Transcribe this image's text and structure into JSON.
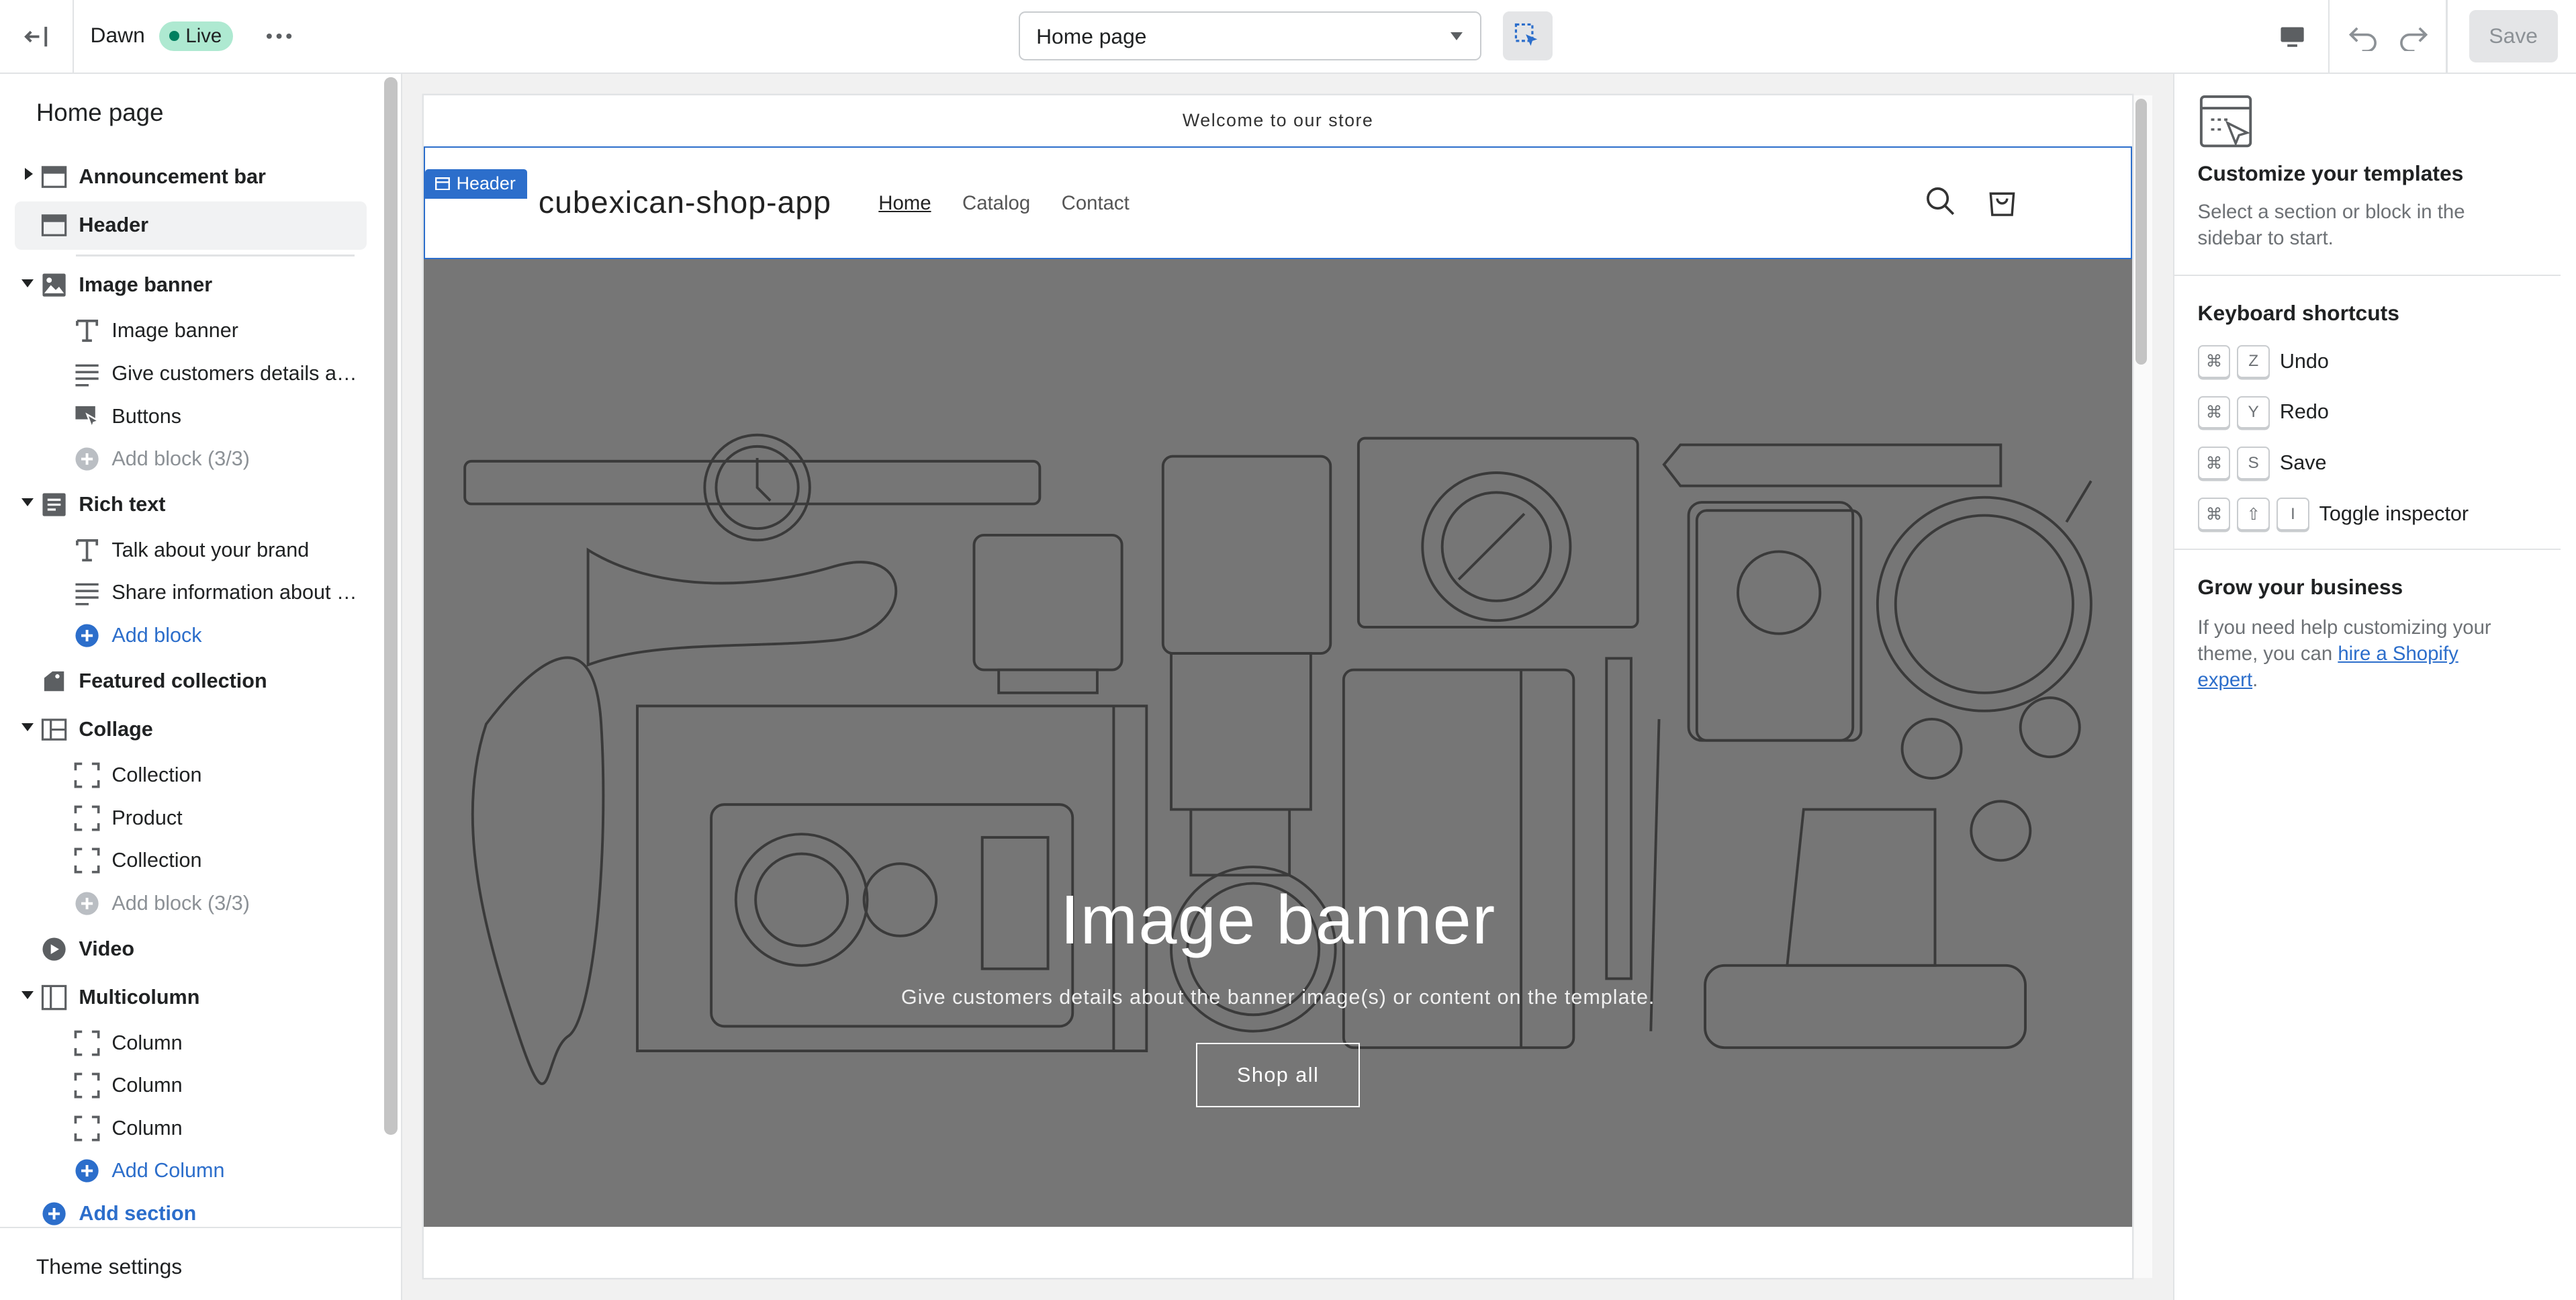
{
  "topbar": {
    "theme_name": "Dawn",
    "live_label": "Live",
    "template_select": "Home page",
    "save_label": "Save"
  },
  "sidebar": {
    "title": "Home page",
    "rows": [
      {
        "kind": "sec",
        "arrow": "right",
        "icon": "announcement-bar-icon",
        "label": "Announcement bar"
      },
      {
        "kind": "sec",
        "sel": true,
        "icon": "header-icon",
        "label": "Header"
      },
      {
        "kind": "sep"
      },
      {
        "kind": "sec",
        "arrow": "down",
        "icon": "image-icon",
        "label": "Image banner"
      },
      {
        "kind": "blk",
        "icon": "text-icon",
        "label": "Image banner"
      },
      {
        "kind": "blk",
        "icon": "paragraph-icon",
        "label": "Give customers details abo..."
      },
      {
        "kind": "blk",
        "icon": "buttons-icon",
        "label": "Buttons"
      },
      {
        "kind": "blk",
        "dis": true,
        "icon": "add-circle-icon",
        "label": "Add block (3/3)"
      },
      {
        "kind": "sec",
        "arrow": "down",
        "icon": "rich-text-icon",
        "label": "Rich text"
      },
      {
        "kind": "blk",
        "icon": "text-icon",
        "label": "Talk about your brand"
      },
      {
        "kind": "blk",
        "icon": "paragraph-icon",
        "label": "Share information about yo..."
      },
      {
        "kind": "blk",
        "add": true,
        "icon": "add-circle-icon",
        "label": "Add block"
      },
      {
        "kind": "sec",
        "icon": "featured-collection-icon",
        "label": "Featured collection"
      },
      {
        "kind": "sec",
        "arrow": "down",
        "icon": "collage-icon",
        "label": "Collage"
      },
      {
        "kind": "blk",
        "icon": "block-frame-icon",
        "label": "Collection"
      },
      {
        "kind": "blk",
        "icon": "block-frame-icon",
        "label": "Product"
      },
      {
        "kind": "blk",
        "icon": "block-frame-icon",
        "label": "Collection"
      },
      {
        "kind": "blk",
        "dis": true,
        "icon": "add-circle-icon",
        "label": "Add block (3/3)"
      },
      {
        "kind": "sec",
        "icon": "video-icon",
        "label": "Video"
      },
      {
        "kind": "sec",
        "arrow": "down",
        "icon": "multicolumn-icon",
        "label": "Multicolumn"
      },
      {
        "kind": "blk",
        "icon": "block-frame-icon",
        "label": "Column"
      },
      {
        "kind": "blk",
        "icon": "block-frame-icon",
        "label": "Column"
      },
      {
        "kind": "blk",
        "icon": "block-frame-icon",
        "label": "Column"
      },
      {
        "kind": "blk",
        "add": true,
        "icon": "add-circle-icon",
        "label": "Add Column"
      },
      {
        "kind": "sec",
        "add": true,
        "icon": "add-circle-icon",
        "label": "Add section"
      }
    ],
    "footer_label": "Theme settings"
  },
  "preview": {
    "announcement": "Welcome to our store",
    "header_tag": "Header",
    "logo": "cubexican-shop-app",
    "nav": [
      "Home",
      "Catalog",
      "Contact"
    ],
    "banner_title": "Image banner",
    "banner_subtitle": "Give customers details about the banner image(s) or content on the template.",
    "banner_button": "Shop all"
  },
  "right_panel": {
    "customize_title": "Customize your templates",
    "customize_text": "Select a section or block in the sidebar to start.",
    "shortcuts_title": "Keyboard shortcuts",
    "shortcuts": [
      {
        "keys": [
          "⌘",
          "Z"
        ],
        "label": "Undo"
      },
      {
        "keys": [
          "⌘",
          "Y"
        ],
        "label": "Redo"
      },
      {
        "keys": [
          "⌘",
          "S"
        ],
        "label": "Save"
      },
      {
        "keys": [
          "⌘",
          "⇧",
          "I"
        ],
        "label": "Toggle inspector"
      }
    ],
    "grow_title": "Grow your business",
    "grow_text_before": "If you need help customizing your theme, you can ",
    "grow_link": "hire a Shopify expert",
    "grow_text_after": "."
  },
  "colors": {
    "accent": "#2c6ecb",
    "live_badge": "#aee9d1",
    "banner_overlay": "#767676"
  }
}
